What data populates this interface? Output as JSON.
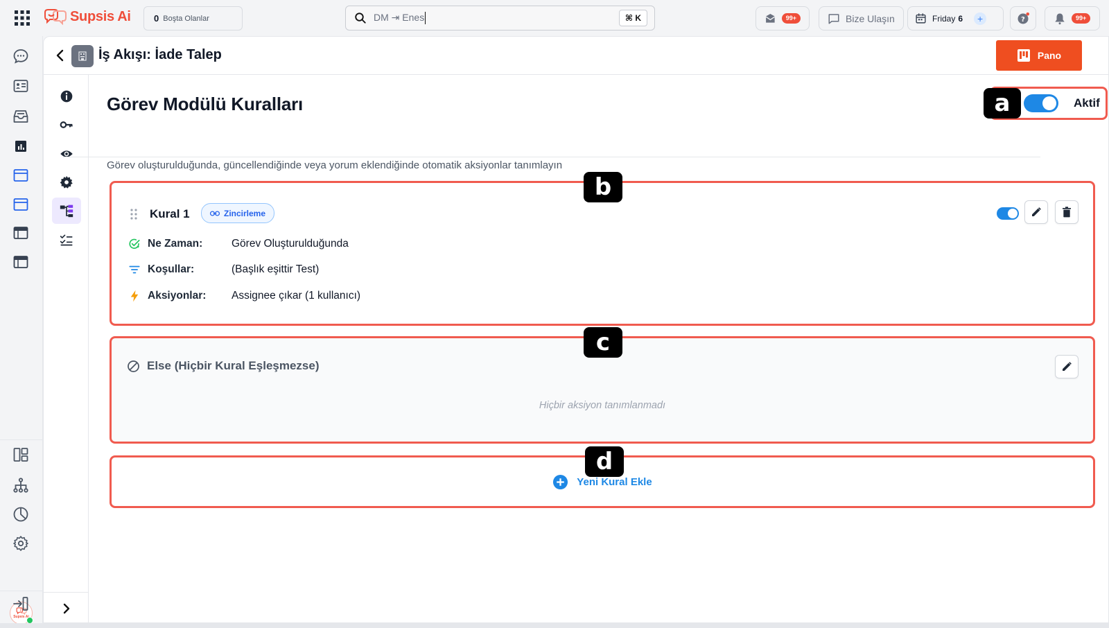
{
  "app": {
    "name": "Supsis Ai",
    "accent": "#ef4e3a"
  },
  "topbar": {
    "idle": {
      "count": "0",
      "label": "Boşta Olanlar"
    },
    "search": {
      "value": "DM ⇥ Enes",
      "shortcut": "⌘ K"
    },
    "mail_badge": "99+",
    "contact_label": "Bize Ulaşın",
    "date": {
      "day_name": "Friday",
      "day_num": "6"
    },
    "notif_badge": "99+"
  },
  "leftnav": {
    "icons": [
      "chat-icon",
      "contact-card-icon",
      "inbox-icon",
      "report-icon",
      "window-icon",
      "window-icon",
      "browser-icon",
      "browser-icon"
    ],
    "bottom_icons": [
      "layout-icon",
      "hierarchy-icon",
      "pie-chart-icon",
      "settings-icon"
    ],
    "avatar_text": "Supsis Ai"
  },
  "header": {
    "title": "İş Akışı: İade Talep",
    "pano_label": "Pano"
  },
  "subnav": {
    "icons": [
      "info-icon",
      "key-icon",
      "eye-icon",
      "gear-icon",
      "workflow-icon",
      "checklist-icon"
    ],
    "active": "workflow-icon"
  },
  "page": {
    "title": "Görev Modülü Kuralları",
    "description": "Görev oluşturulduğunda, güncellendiğinde veya yorum eklendiğinde otomatik aksiyonlar tanımlayın",
    "active_toggle": {
      "label": "Aktif",
      "on": true
    }
  },
  "markers": {
    "a": "a",
    "b": "b",
    "c": "c",
    "d": "d"
  },
  "rule": {
    "name": "Kural 1",
    "badge": "Zincirleme",
    "enabled": true,
    "rows": [
      {
        "key": "Ne Zaman:",
        "value": "Görev Oluşturulduğunda",
        "icon": "check-circle-icon"
      },
      {
        "key": "Koşullar:",
        "value": "(Başlık eşittir Test)",
        "icon": "filter-icon"
      },
      {
        "key": "Aksiyonlar:",
        "value": "Assignee çıkar (1 kullanıcı)",
        "icon": "bolt-icon"
      }
    ]
  },
  "else_block": {
    "title": "Else (Hiçbir Kural Eşleşmezse)",
    "empty": "Hiçbir aksiyon tanımlanmadı"
  },
  "add_rule": {
    "label": "Yeni Kural Ekle"
  },
  "colors": {
    "blue": "#1e88e5",
    "orange": "#ef4e20",
    "highlight": "#f05b4f"
  }
}
